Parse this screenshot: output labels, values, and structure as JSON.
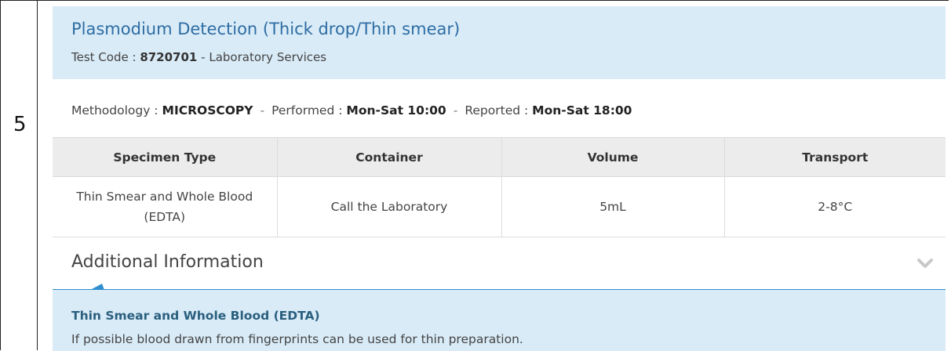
{
  "row_number": "5",
  "test": {
    "name": "Plasmodium Detection (Thick drop/Thin smear)",
    "code_label": "Test Code :",
    "code": "8720701",
    "code_suffix": "- Laboratory Services"
  },
  "method": {
    "methodology_label": "Methodology :",
    "methodology": "MICROSCOPY",
    "performed_label": "Performed :",
    "performed": "Mon-Sat 10:00",
    "reported_label": "Reported :",
    "reported": "Mon-Sat 18:00",
    "separator": "-"
  },
  "specimen_table": {
    "headers": [
      "Specimen Type",
      "Container",
      "Volume",
      "Transport"
    ],
    "rows": [
      [
        "Thin Smear and Whole Blood (EDTA)",
        "Call the Laboratory",
        "5mL",
        "2-8°C"
      ]
    ]
  },
  "additional": {
    "title": "Additional Information",
    "toggle_icon": "chevron-down-icon",
    "note_title": "Thin Smear and Whole Blood (EDTA)",
    "note_text": "If possible blood drawn from fingerprints can be used for thin preparation."
  },
  "colors": {
    "header_bg": "#d9ebf7",
    "title": "#2e6da4",
    "accent_line": "#2f8fce",
    "note_title": "#2a5f7e"
  }
}
